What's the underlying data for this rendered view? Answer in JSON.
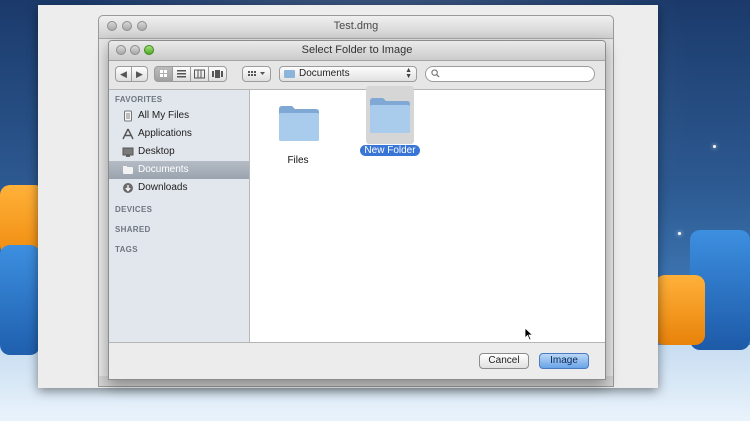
{
  "back_window": {
    "title": "Test.dmg"
  },
  "dialog": {
    "title": "Select Folder to Image",
    "toolbar": {
      "back_glyph": "◀",
      "forward_glyph": "▶",
      "path_popup_value": "Documents",
      "search_value": ""
    },
    "sidebar": {
      "sections": {
        "favorites": "FAVORITES",
        "devices": "DEVICES",
        "shared": "SHARED",
        "tags": "TAGS"
      },
      "items": [
        {
          "label": "All My Files",
          "icon": "all-files-icon"
        },
        {
          "label": "Applications",
          "icon": "applications-icon"
        },
        {
          "label": "Desktop",
          "icon": "desktop-icon"
        },
        {
          "label": "Documents",
          "icon": "documents-icon",
          "selected": true
        },
        {
          "label": "Downloads",
          "icon": "downloads-icon"
        }
      ]
    },
    "files": [
      {
        "name": "Files",
        "icon": "folder-icon",
        "selected": false
      },
      {
        "name": "New Folder",
        "icon": "folder-icon",
        "selected": true
      }
    ],
    "buttons": {
      "cancel": "Cancel",
      "primary": "Image"
    }
  },
  "colors": {
    "selection": "#3875d7",
    "sidebar_bg": "#e2e7ed",
    "folder": "#8db5db"
  }
}
